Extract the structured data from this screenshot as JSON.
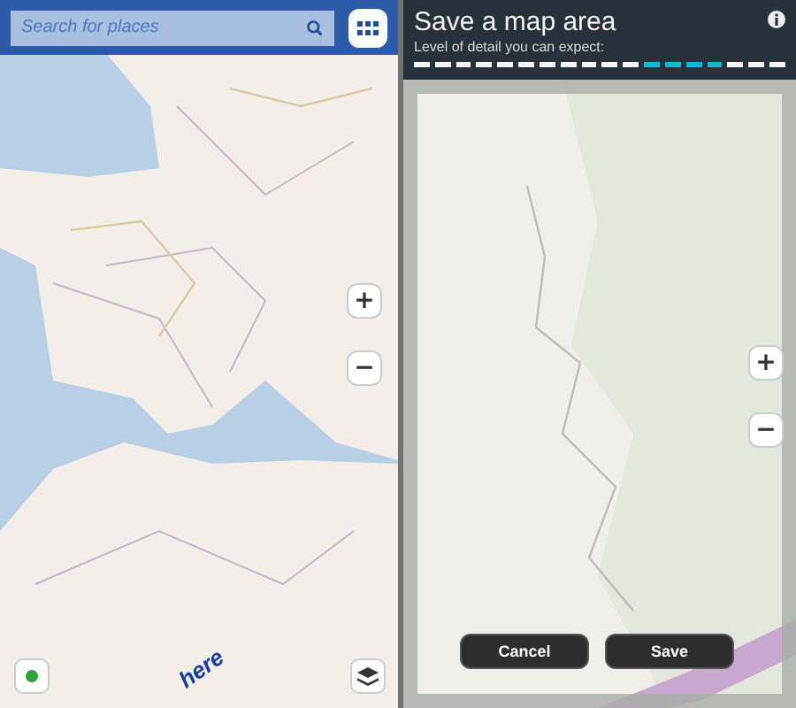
{
  "left_screen": {
    "search": {
      "placeholder": "Search for places"
    },
    "zoom_in": "+",
    "zoom_out": "−",
    "logo": "here"
  },
  "right_screen": {
    "title": "Save a map area",
    "subtitle": "Level of detail you can expect:",
    "detail_segments": [
      {
        "selected": false
      },
      {
        "selected": false
      },
      {
        "selected": false
      },
      {
        "selected": false
      },
      {
        "selected": false
      },
      {
        "selected": false
      },
      {
        "selected": false
      },
      {
        "selected": false
      },
      {
        "selected": false
      },
      {
        "selected": false
      },
      {
        "selected": false
      },
      {
        "selected": true
      },
      {
        "selected": true
      },
      {
        "selected": true
      },
      {
        "selected": true
      },
      {
        "selected": false
      },
      {
        "selected": false
      },
      {
        "selected": false
      }
    ],
    "zoom_in": "+",
    "zoom_out": "−",
    "buttons": [
      "Cancel",
      "Save"
    ]
  }
}
